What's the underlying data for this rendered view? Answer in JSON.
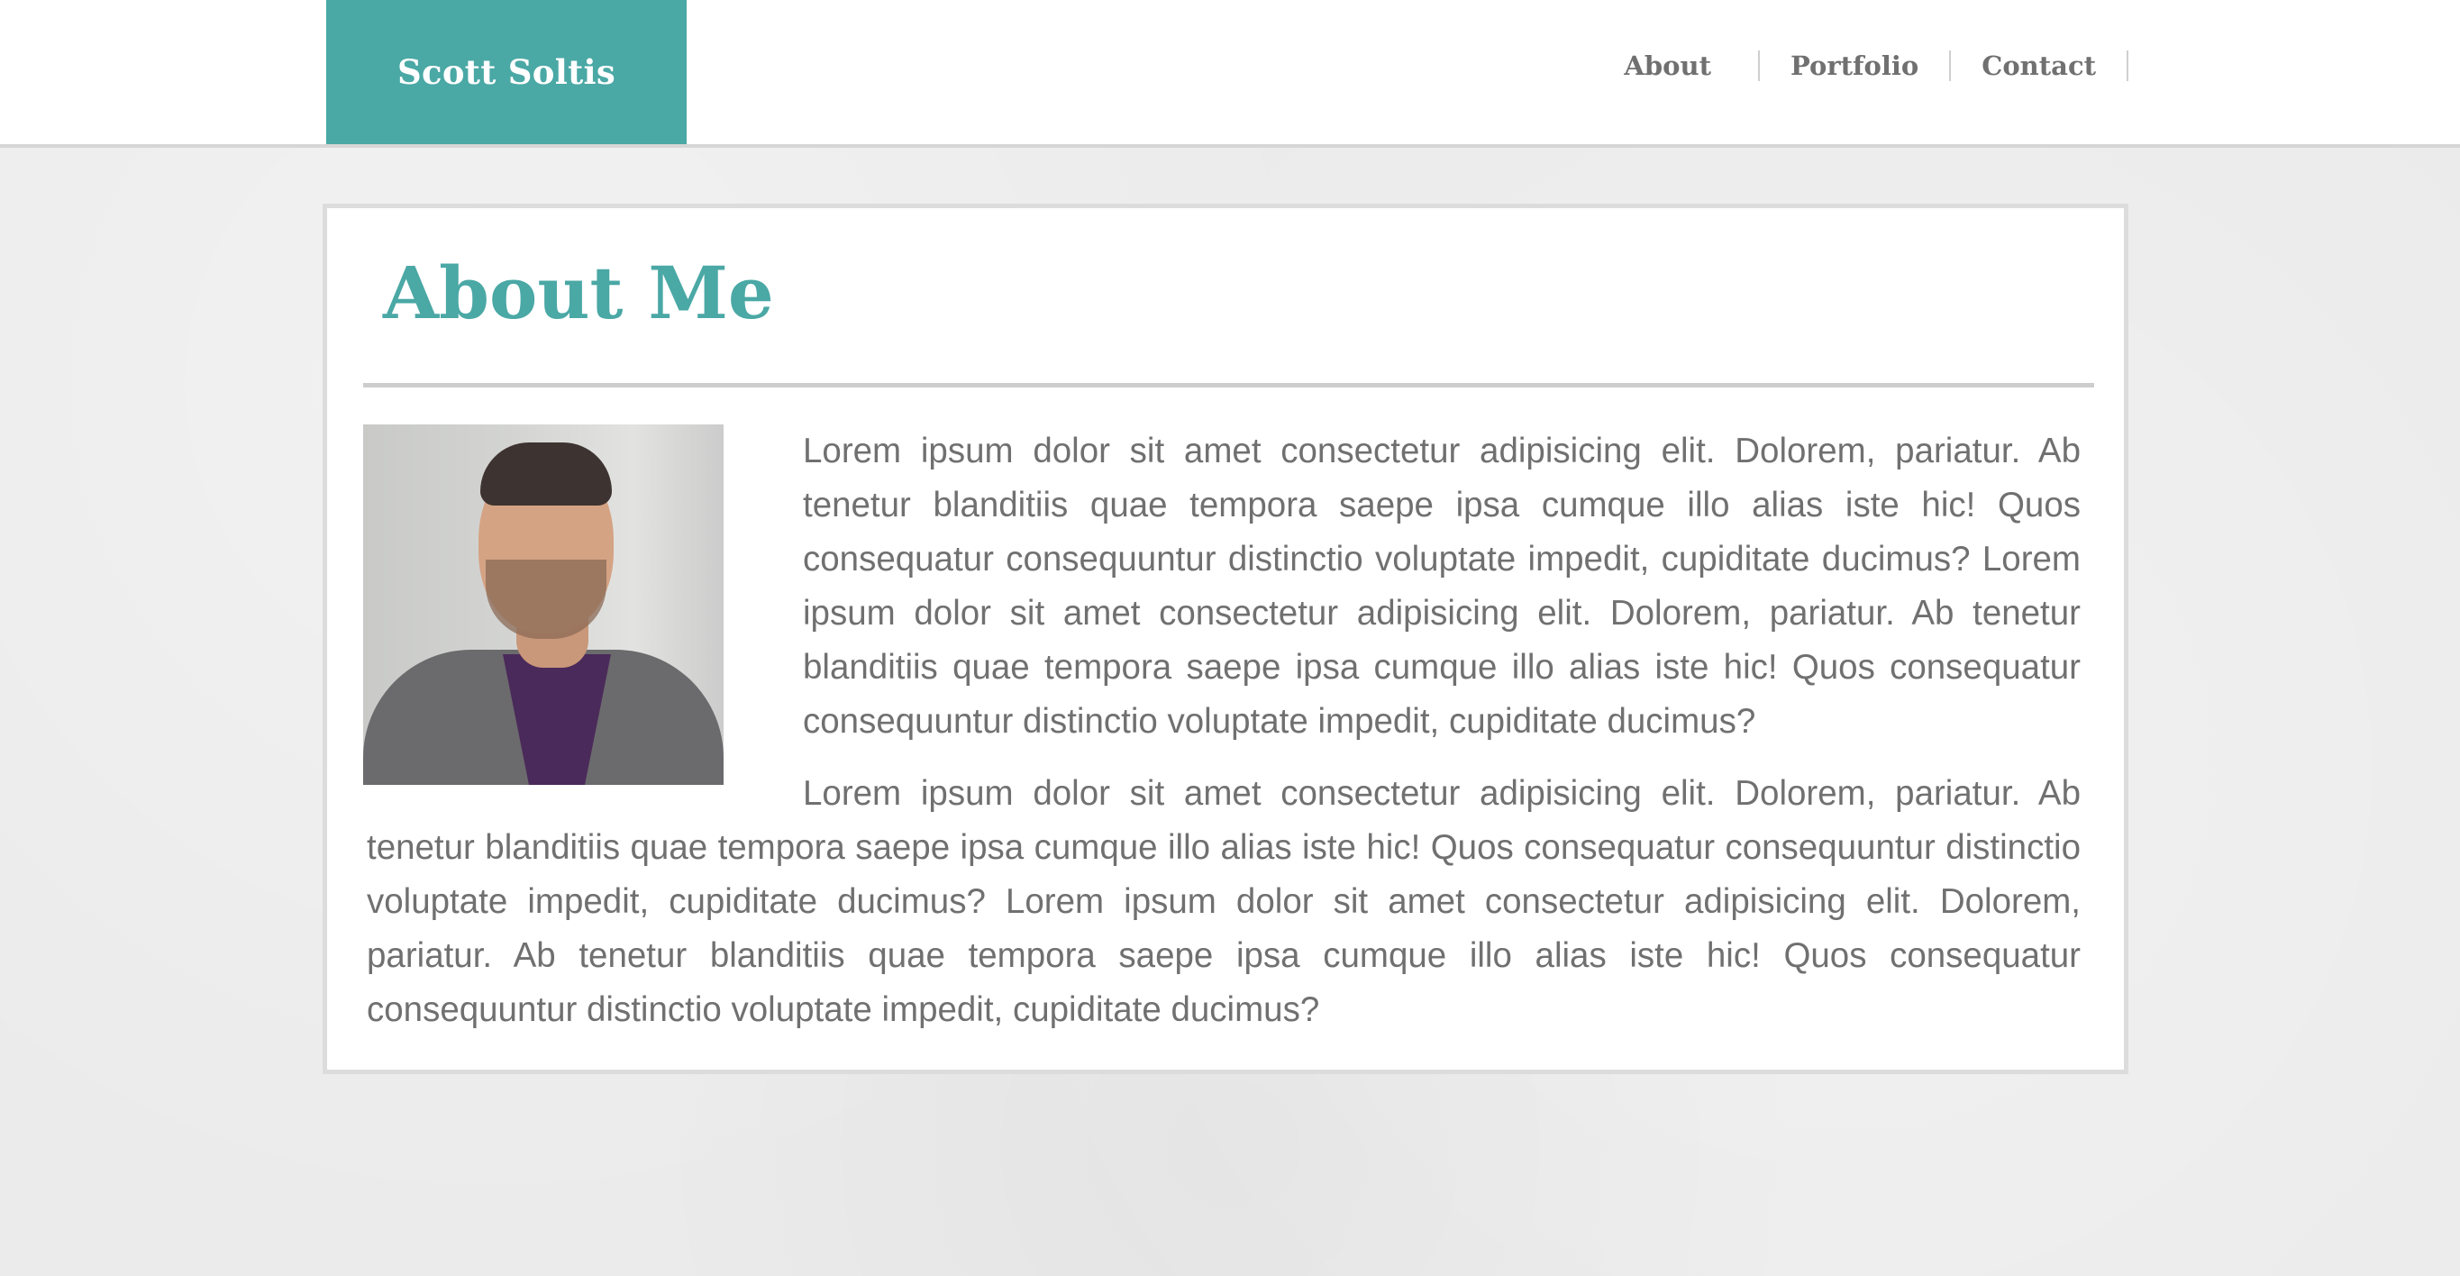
{
  "brand": {
    "name": "Scott Soltis",
    "accent_color": "#4aa8a5"
  },
  "nav": {
    "items": [
      {
        "label": "About"
      },
      {
        "label": "Portfolio"
      },
      {
        "label": "Contact"
      }
    ]
  },
  "main": {
    "title": "About Me",
    "portrait_alt": "Portrait of Scott Soltis",
    "paragraphs": [
      "Lorem ipsum dolor sit amet consectetur adipisicing elit. Dolorem, pariatur. Ab tenetur blanditiis quae tempora saepe ipsa cumque illo alias iste hic! Quos consequatur consequuntur distinctio voluptate impedit, cupiditate ducimus? Lorem ipsum dolor sit amet consectetur adipisicing elit. Dolorem, pariatur. Ab tenetur blanditiis quae tempora saepe ipsa cumque illo alias iste hic! Quos consequatur consequuntur distinctio voluptate impedit, cupiditate ducimus?",
      "Lorem ipsum dolor sit amet consectetur adipisicing elit. Dolorem, pariatur. Ab tenetur blanditiis quae tempora saepe ipsa cumque illo alias iste hic! Quos consequatur consequuntur distinctio voluptate impedit, cupiditate ducimus? Lorem ipsum dolor sit amet consectetur adipisicing elit. Dolorem, pariatur. Ab tenetur blanditiis quae tempora saepe ipsa cumque illo alias iste hic! Quos consequatur consequuntur distinctio voluptate impedit, cupiditate ducimus?"
    ]
  }
}
